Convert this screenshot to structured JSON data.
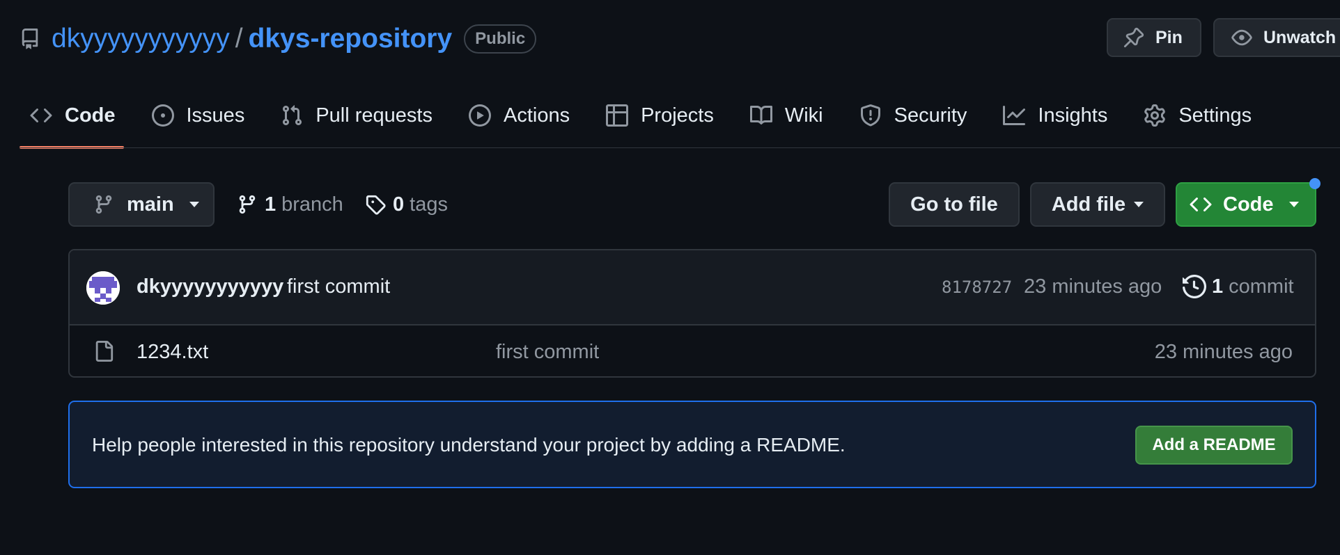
{
  "header": {
    "owner": "dkyyyyyyyyyyy",
    "separator": "/",
    "repo": "dkys-repository",
    "visibility": "Public",
    "pin_label": "Pin",
    "unwatch_label": "Unwatch"
  },
  "tabs": [
    {
      "label": "Code",
      "icon": "code-icon",
      "active": true
    },
    {
      "label": "Issues",
      "icon": "issue-icon"
    },
    {
      "label": "Pull requests",
      "icon": "pull-request-icon"
    },
    {
      "label": "Actions",
      "icon": "play-icon"
    },
    {
      "label": "Projects",
      "icon": "table-icon"
    },
    {
      "label": "Wiki",
      "icon": "book-icon"
    },
    {
      "label": "Security",
      "icon": "shield-icon"
    },
    {
      "label": "Insights",
      "icon": "graph-icon"
    },
    {
      "label": "Settings",
      "icon": "gear-icon"
    }
  ],
  "toolbar": {
    "branch": "main",
    "branch_count": "1",
    "branch_word": "branch",
    "tag_count": "0",
    "tag_word": "tags",
    "goto_label": "Go to file",
    "addfile_label": "Add file",
    "code_label": "Code"
  },
  "latest_commit": {
    "author": "dkyyyyyyyyyyy",
    "message": "first commit",
    "sha": "8178727",
    "time": "23 minutes ago",
    "count": "1",
    "count_word": "commit"
  },
  "files": [
    {
      "name": "1234.txt",
      "message": "first commit",
      "time": "23 minutes ago"
    }
  ],
  "readme_banner": {
    "text": "Help people interested in this repository understand your project by adding a README.",
    "button": "Add a README"
  },
  "colors": {
    "background": "#0d1117",
    "link": "#4493f8",
    "tab_underline": "#f78166",
    "code_button": "#238636",
    "readme_border": "#1f6feb"
  }
}
